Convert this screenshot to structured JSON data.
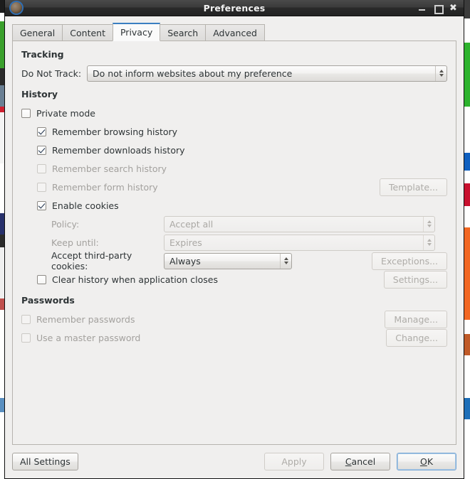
{
  "window": {
    "title": "Preferences",
    "icon": "browser-app-icon",
    "controls": {
      "minimize": "–",
      "maximize": "□",
      "close": "✖"
    }
  },
  "tabs": [
    {
      "label": "General",
      "active": false
    },
    {
      "label": "Content",
      "active": false
    },
    {
      "label": "Privacy",
      "active": true
    },
    {
      "label": "Search",
      "active": false
    },
    {
      "label": "Advanced",
      "active": false
    }
  ],
  "sections": {
    "tracking": {
      "title": "Tracking",
      "do_not_track_label": "Do Not Track:",
      "do_not_track_value": "Do not inform websites about my preference"
    },
    "history": {
      "title": "History",
      "private_mode": {
        "label": "Private mode",
        "checked": false,
        "enabled": true
      },
      "remember_browsing": {
        "label": "Remember browsing history",
        "checked": true,
        "enabled": true
      },
      "remember_downloads": {
        "label": "Remember downloads history",
        "checked": true,
        "enabled": true
      },
      "remember_search": {
        "label": "Remember search history",
        "checked": false,
        "enabled": false
      },
      "remember_form": {
        "label": "Remember form history",
        "checked": false,
        "enabled": false
      },
      "template_button": {
        "label": "Template...",
        "enabled": false
      },
      "enable_cookies": {
        "label": "Enable cookies",
        "checked": true,
        "enabled": true
      },
      "policy_label": "Policy:",
      "policy_value": "Accept all",
      "policy_enabled": false,
      "keep_until_label": "Keep until:",
      "keep_until_value": "Expires",
      "keep_until_enabled": false,
      "third_party_label": "Accept third-party cookies:",
      "third_party_value": "Always",
      "exceptions_button": {
        "label": "Exceptions...",
        "enabled": false
      },
      "clear_history": {
        "label": "Clear history when application closes",
        "checked": false,
        "enabled": true
      },
      "settings_button": {
        "label": "Settings...",
        "enabled": false
      }
    },
    "passwords": {
      "title": "Passwords",
      "remember_passwords": {
        "label": "Remember passwords",
        "checked": false,
        "enabled": false
      },
      "manage_button": {
        "label": "Manage...",
        "enabled": false
      },
      "use_master_password": {
        "label": "Use a master password",
        "checked": false,
        "enabled": false
      },
      "change_button": {
        "label": "Change...",
        "enabled": false
      }
    }
  },
  "actions": {
    "all_settings": "All Settings",
    "apply": "Apply",
    "cancel_prefix": "",
    "cancel_accel": "C",
    "cancel_rest": "ancel",
    "ok_accel": "O",
    "ok_rest": "K"
  },
  "colors": {
    "accent": "#3a7fc1",
    "window_bg": "#f0efee",
    "panel_bg": "#f0efee",
    "titlebar": "#2a2a2a",
    "text": "#2e3436",
    "text_disabled": "#a3a19e"
  }
}
